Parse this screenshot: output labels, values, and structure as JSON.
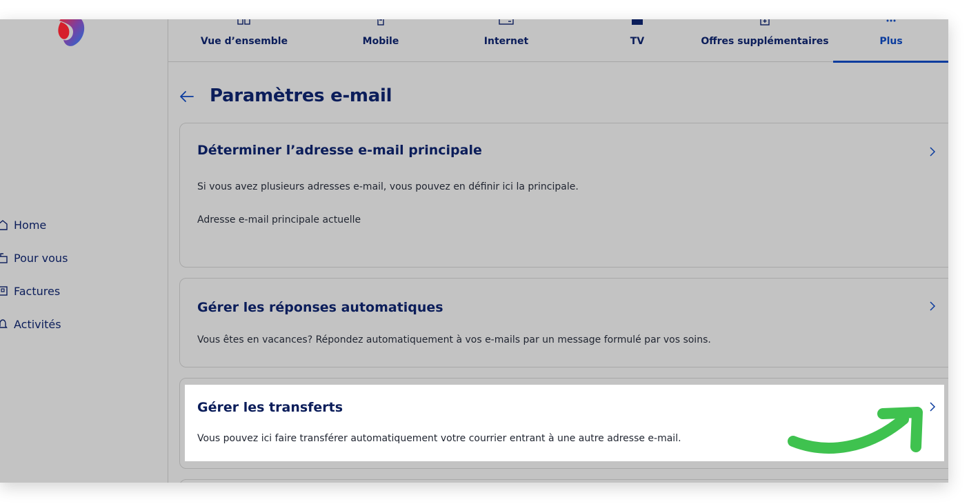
{
  "sidebar": {
    "items": [
      {
        "label": "Home",
        "icon": "home-icon"
      },
      {
        "label": "Pour vous",
        "icon": "gift-icon"
      },
      {
        "label": "Factures",
        "icon": "invoice-icon"
      },
      {
        "label": "Activités",
        "icon": "bell-icon"
      }
    ]
  },
  "tabs": [
    {
      "label": "Vue d’ensemble",
      "icon": "overview-icon"
    },
    {
      "label": "Mobile",
      "icon": "mobile-icon"
    },
    {
      "label": "Internet",
      "icon": "router-icon"
    },
    {
      "label": "TV",
      "icon": "tv-icon"
    },
    {
      "label": "Offres supplémentaires",
      "icon": "plus-box-icon"
    },
    {
      "label": "Plus",
      "icon": "more-icon",
      "active": true
    }
  ],
  "page": {
    "title": "Paramètres e-mail"
  },
  "cards": [
    {
      "title": "Déterminer l’adresse e-mail principale",
      "description": "Si vous avez plusieurs adresses e-mail, vous pouvez en définir ici la principale.",
      "subtext": "Adresse e-mail principale actuelle"
    },
    {
      "title": "Gérer les réponses automatiques",
      "description": "Vous êtes en vacances? Répondez automatiquement à vos e-mails par un message formulé par vos soins."
    },
    {
      "title": "Gérer les transferts",
      "description": "Vous pouvez ici faire transférer automatiquement votre courrier entrant à une autre adresse e-mail.",
      "highlighted": true
    }
  ],
  "colors": {
    "brand_navy": "#0b1d5a",
    "accent_blue": "#0b3c9e",
    "overlay_gray": "#c3c3c3",
    "annotation_green": "#3fc24f"
  }
}
